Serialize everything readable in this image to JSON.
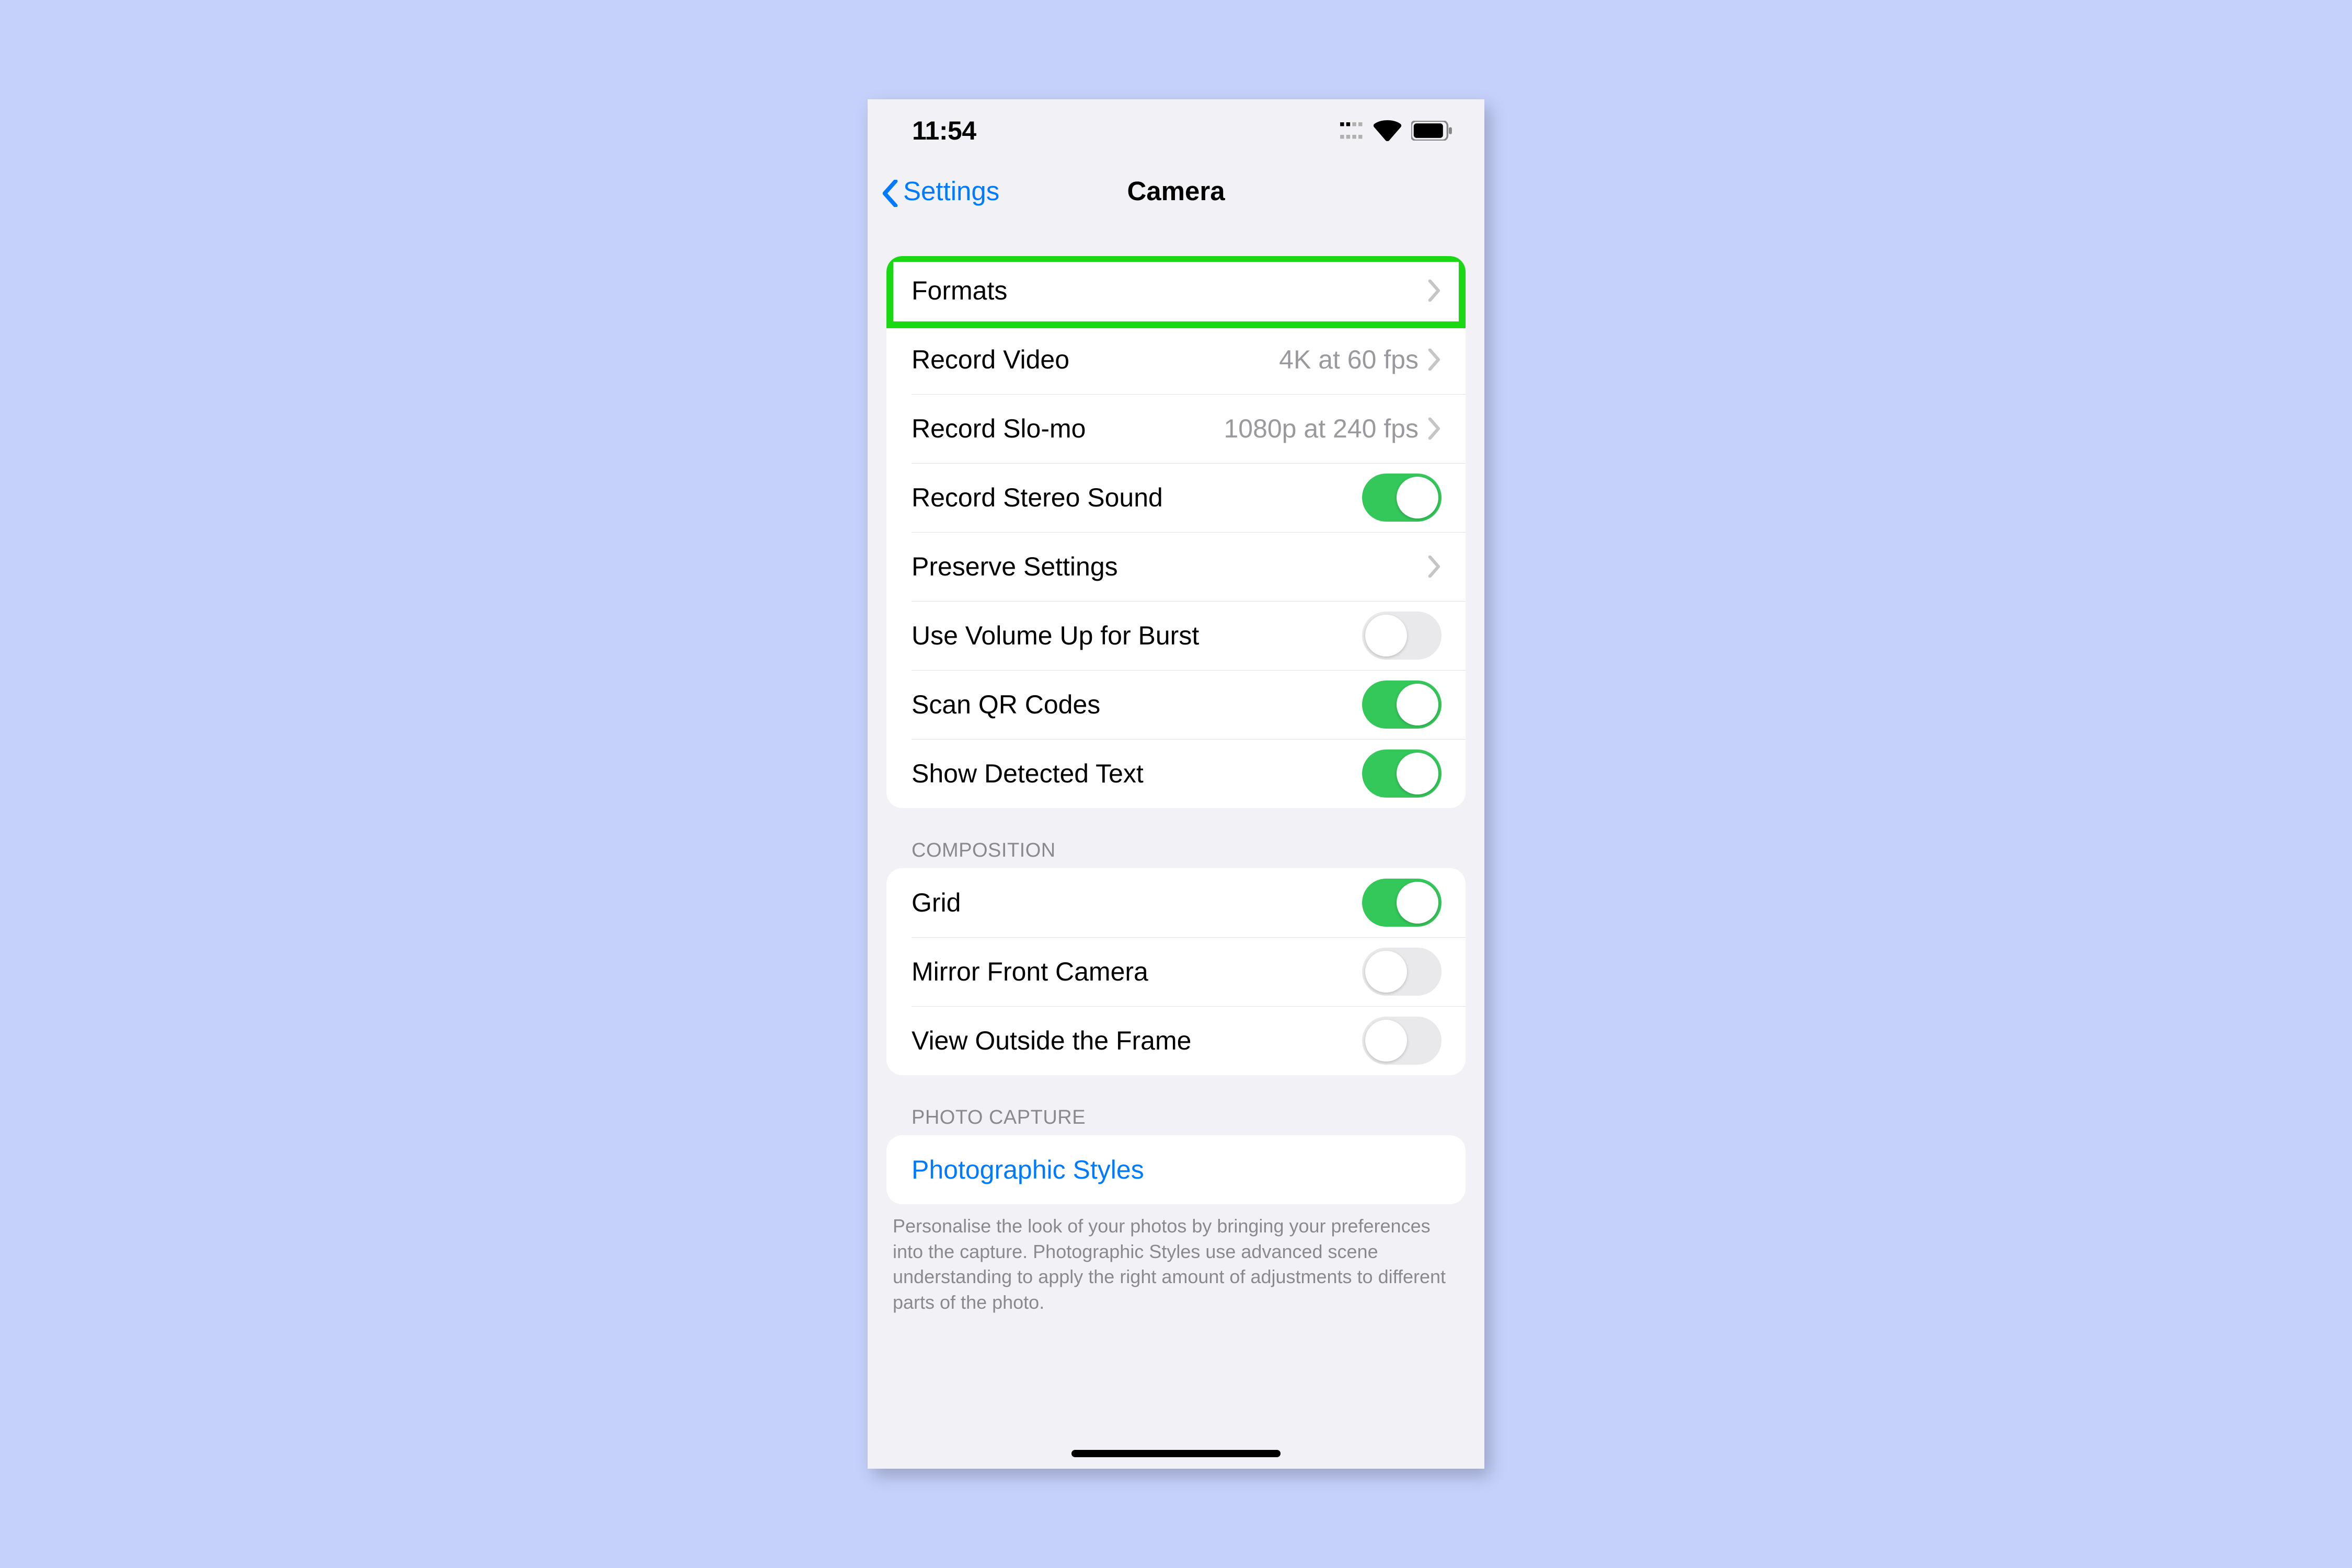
{
  "statusbar": {
    "time": "11:54"
  },
  "nav": {
    "back": "Settings",
    "title": "Camera"
  },
  "group1": {
    "rows": [
      {
        "label": "Formats",
        "value": "",
        "type": "disclosure",
        "highlighted": true
      },
      {
        "label": "Record Video",
        "value": "4K at 60 fps",
        "type": "disclosure"
      },
      {
        "label": "Record Slo-mo",
        "value": "1080p at 240 fps",
        "type": "disclosure"
      },
      {
        "label": "Record Stereo Sound",
        "type": "toggle",
        "on": true
      },
      {
        "label": "Preserve Settings",
        "value": "",
        "type": "disclosure"
      },
      {
        "label": "Use Volume Up for Burst",
        "type": "toggle",
        "on": false
      },
      {
        "label": "Scan QR Codes",
        "type": "toggle",
        "on": true
      },
      {
        "label": "Show Detected Text",
        "type": "toggle",
        "on": true
      }
    ]
  },
  "group2": {
    "header": "COMPOSITION",
    "rows": [
      {
        "label": "Grid",
        "type": "toggle",
        "on": true
      },
      {
        "label": "Mirror Front Camera",
        "type": "toggle",
        "on": false
      },
      {
        "label": "View Outside the Frame",
        "type": "toggle",
        "on": false
      }
    ]
  },
  "group3": {
    "header": "PHOTO CAPTURE",
    "rows": [
      {
        "label": "Photographic Styles",
        "type": "link"
      }
    ],
    "footer": "Personalise the look of your photos by bringing your preferences into the capture. Photographic Styles use advanced scene understanding to apply the right amount of adjustments to different parts of the photo."
  }
}
